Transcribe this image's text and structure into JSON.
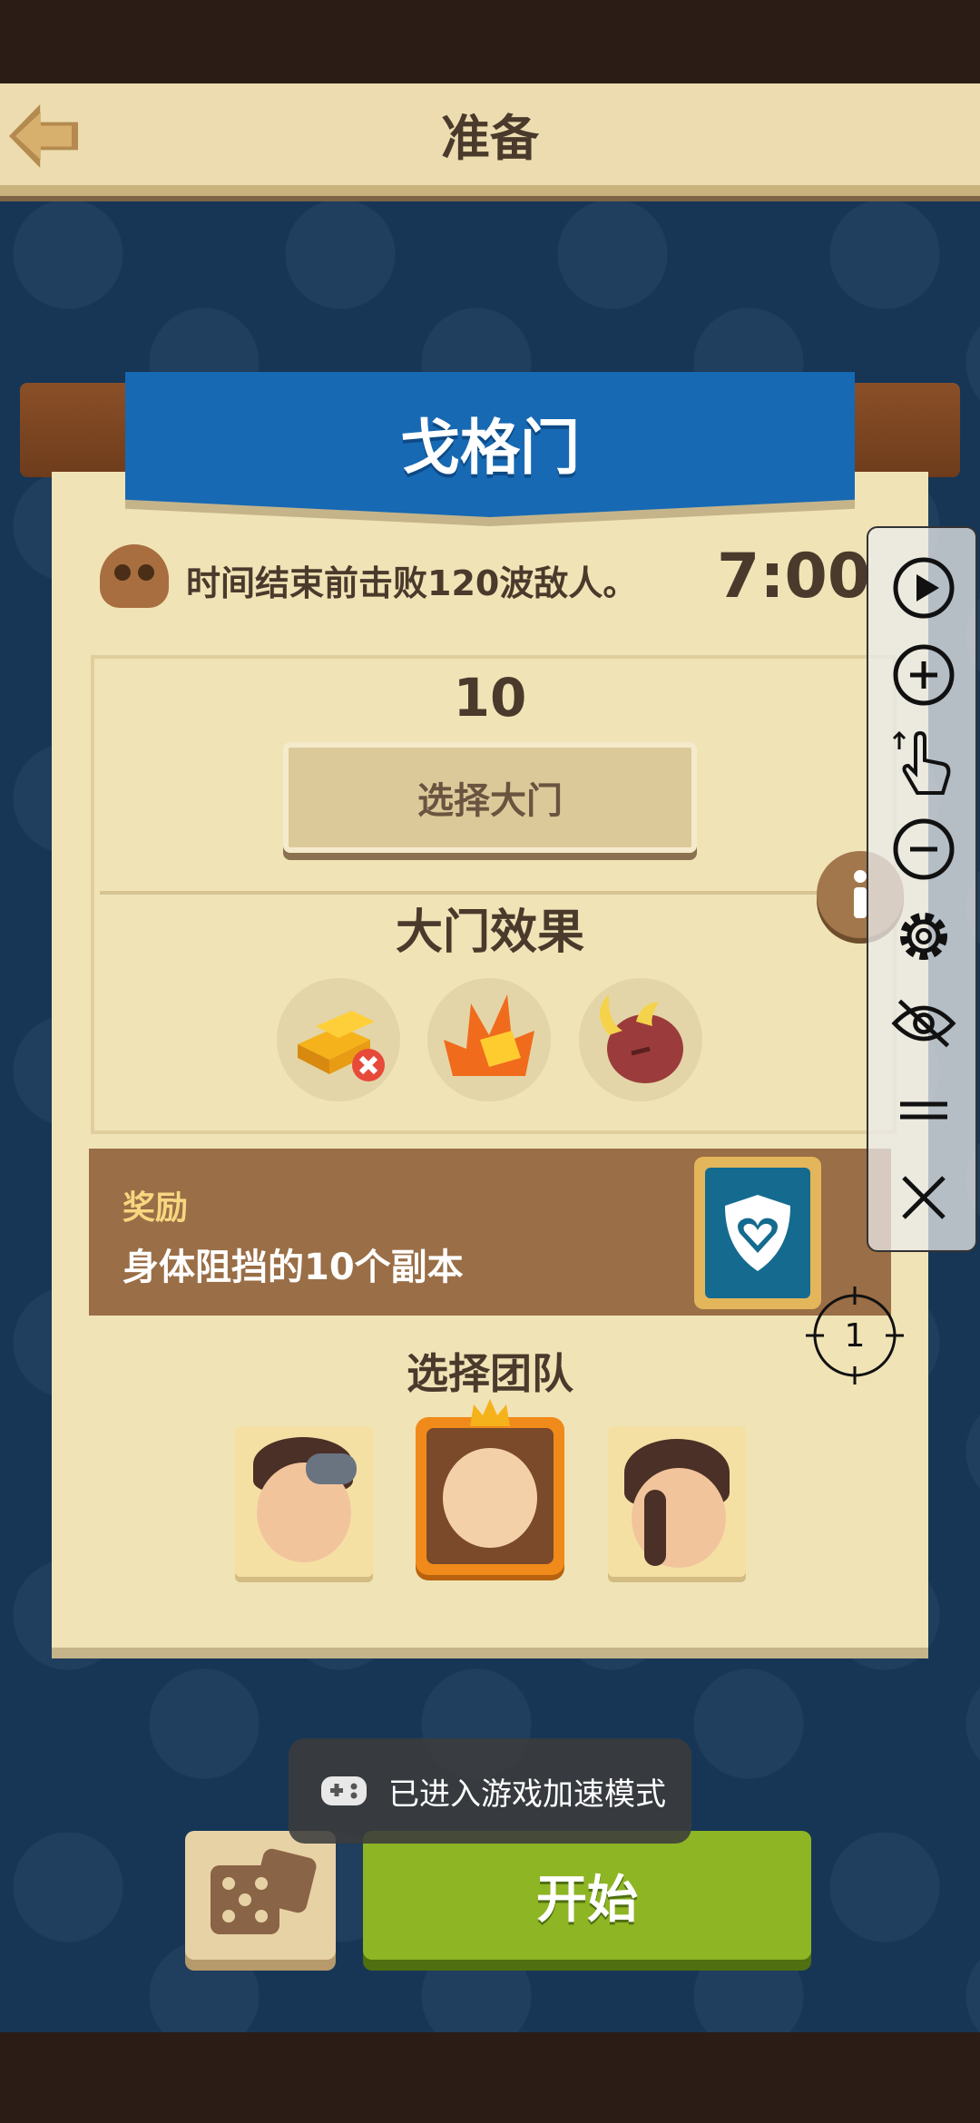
{
  "header": {
    "title": "准备"
  },
  "level": {
    "name": "戈格门"
  },
  "objective": {
    "text": "时间结束前击败120波敌人。",
    "timer": "7:00"
  },
  "gate": {
    "count": "10",
    "select_label": "选择大门",
    "effects_title": "大门效果"
  },
  "effects": [
    {
      "icon": "gold-bars-no-icon"
    },
    {
      "icon": "fire-gold-icon"
    },
    {
      "icon": "demon-horn-icon"
    }
  ],
  "reward": {
    "label": "奖励",
    "text": "身体阻挡的10个副本",
    "icon": "shield-heart-icon"
  },
  "team": {
    "title": "选择团队",
    "members": [
      {
        "icon": "hero-goggles-portrait",
        "selected": false
      },
      {
        "icon": "hero-monk-portrait",
        "selected": true
      },
      {
        "icon": "hero-ponytail-portrait",
        "selected": false
      }
    ]
  },
  "buttons": {
    "start_label": "开始",
    "dice_icon": "dice-icon"
  },
  "toast": {
    "text": "已进入游戏加速模式"
  },
  "tools": [
    {
      "icon": "play-icon"
    },
    {
      "icon": "zoom-in-icon"
    },
    {
      "icon": "tap-hand-icon"
    },
    {
      "icon": "zoom-out-icon"
    },
    {
      "icon": "settings-icon"
    },
    {
      "icon": "hide-icon"
    },
    {
      "icon": "menu-icon"
    },
    {
      "icon": "close-icon"
    }
  ],
  "crosshair": {
    "label": "1"
  },
  "colors": {
    "banner_blue": "#1769b3",
    "start_green": "#8eb523",
    "panel_bg": "#f0e3b6",
    "reward_brown": "#9a6e46",
    "selected_orange": "#f08a1a"
  }
}
